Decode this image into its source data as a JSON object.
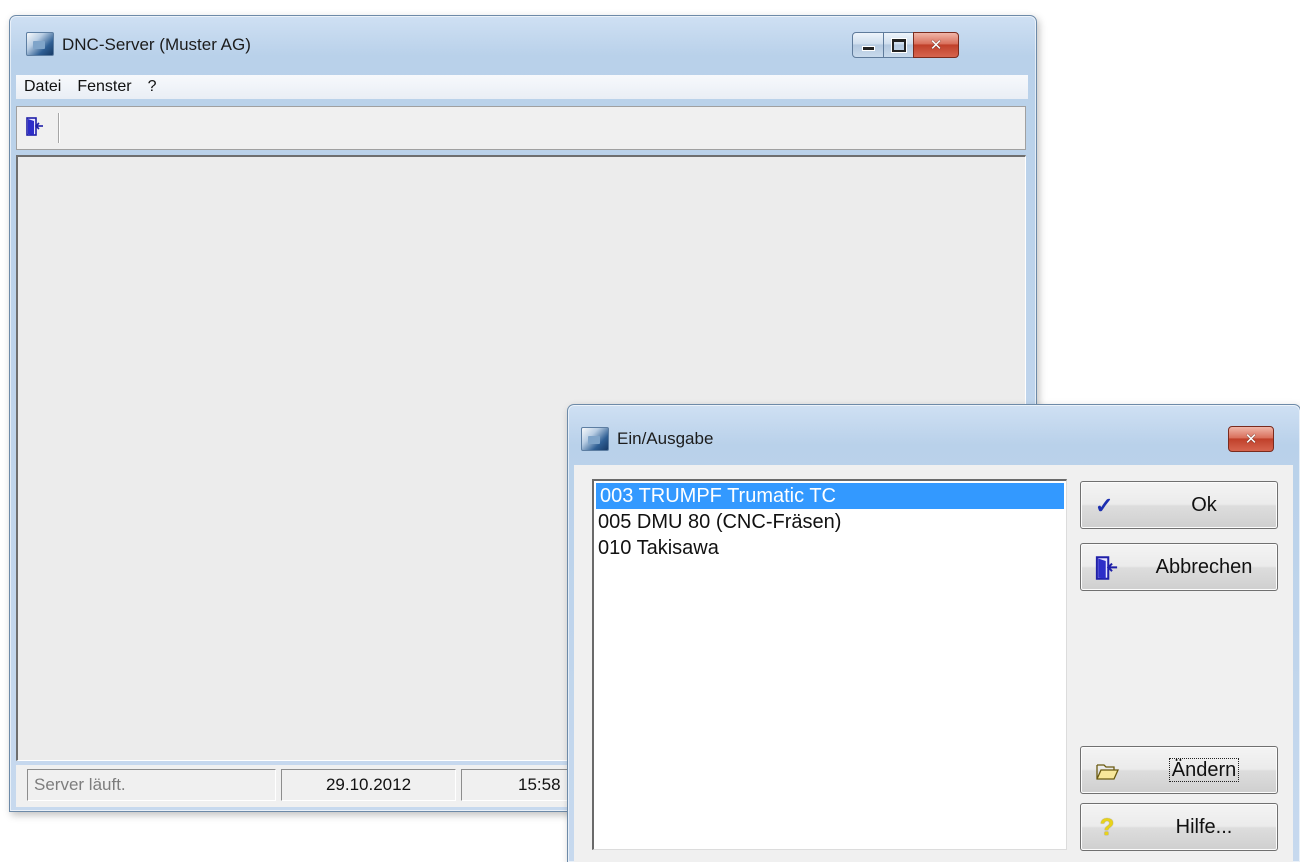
{
  "main_window": {
    "title": "DNC-Server (Muster AG)",
    "menu": [
      "Datei",
      "Fenster",
      "?"
    ],
    "status": {
      "message": "Server läuft.",
      "date": "29.10.2012",
      "time": "15:58"
    }
  },
  "dialog": {
    "title": "Ein/Ausgabe",
    "list_items": [
      "003 TRUMPF Trumatic TC",
      "005 DMU 80 (CNC-Fräsen)",
      "010 Takisawa"
    ],
    "selected_index": 0,
    "buttons": {
      "ok": "Ok",
      "cancel": "Abbrechen",
      "change": "Ändern",
      "help": "Hilfe..."
    }
  },
  "icons": {
    "app": "dnc-app-icon",
    "exit": "door-exit-icon",
    "ok": "check-icon",
    "change": "open-folder-icon",
    "help": "question-icon"
  },
  "colors": {
    "selection": "#3399ff",
    "close_button": "#c8452f",
    "status_text": "#7d7d7d"
  }
}
